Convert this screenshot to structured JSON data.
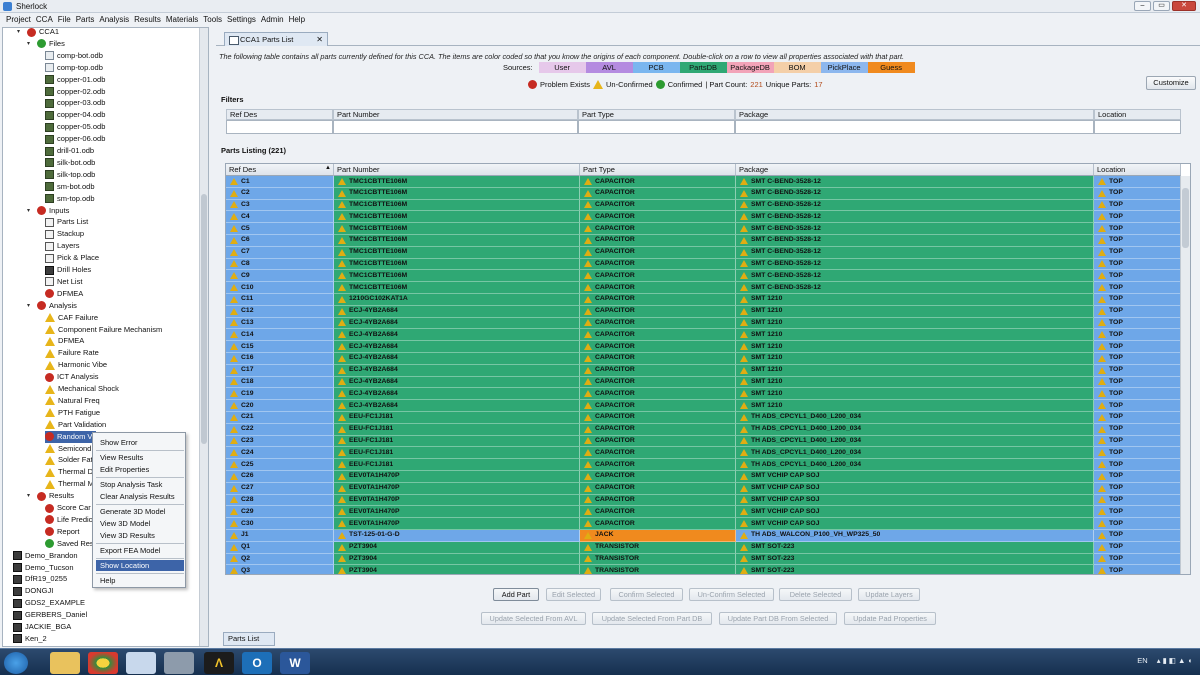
{
  "window": {
    "title": "Sherlock",
    "buttons": [
      "–",
      "▭",
      "✕"
    ]
  },
  "menu": [
    "Project",
    "CCA",
    "File",
    "Parts",
    "Analysis",
    "Results",
    "Materials",
    "Tools",
    "Settings",
    "Admin",
    "Help"
  ],
  "tree": {
    "top_node": "CCA1",
    "files_label": "Files",
    "files": [
      "comp-bot.odb",
      "comp-top.odb",
      "copper-01.odb",
      "copper-02.odb",
      "copper-03.odb",
      "copper-04.odb",
      "copper-05.odb",
      "copper-06.odb",
      "drill-01.odb",
      "silk-bot.odb",
      "silk-top.odb",
      "sm-bot.odb",
      "sm-top.odb"
    ],
    "inputs_label": "Inputs",
    "inputs": [
      {
        "label": "Parts List",
        "icon": "list"
      },
      {
        "label": "Stackup",
        "icon": "list"
      },
      {
        "label": "Layers",
        "icon": "list"
      },
      {
        "label": "Pick & Place",
        "icon": "list"
      },
      {
        "label": "Drill Holes",
        "icon": "dark"
      },
      {
        "label": "Net List",
        "icon": "list"
      },
      {
        "label": "DFMEA",
        "icon": "err"
      }
    ],
    "analysis_label": "Analysis",
    "analysis": [
      {
        "label": "CAF Failure",
        "icon": "warn"
      },
      {
        "label": "Component Failure Mechanism",
        "icon": "warn"
      },
      {
        "label": "DFMEA",
        "icon": "warn"
      },
      {
        "label": "Failure Rate",
        "icon": "warn"
      },
      {
        "label": "Harmonic Vibe",
        "icon": "warn"
      },
      {
        "label": "ICT Analysis",
        "icon": "err"
      },
      {
        "label": "Mechanical Shock",
        "icon": "warn"
      },
      {
        "label": "Natural Freq",
        "icon": "warn"
      },
      {
        "label": "PTH Fatigue",
        "icon": "warn"
      },
      {
        "label": "Part Validation",
        "icon": "warn"
      },
      {
        "label": "Random V",
        "icon": "err"
      },
      {
        "label": "Semicond",
        "icon": "warn"
      },
      {
        "label": "Solder Fati",
        "icon": "warn"
      },
      {
        "label": "Thermal D",
        "icon": "warn"
      },
      {
        "label": "Thermal M",
        "icon": "warn"
      }
    ],
    "results_label": "Results",
    "results": [
      {
        "label": "Score Car",
        "icon": "err"
      },
      {
        "label": "Life Predic",
        "icon": "err"
      },
      {
        "label": "Report",
        "icon": "err"
      },
      {
        "label": "Saved Res",
        "icon": "ok"
      }
    ],
    "projects": [
      "Demo_Brandon",
      "Demo_Tucson",
      "DfR19_0255",
      "DONGJI",
      "GDS2_EXAMPLE",
      "GERBERS_Daniel",
      "JACKIE_BGA",
      "Ken_2",
      "Kevin"
    ]
  },
  "context_menu": [
    "Show Error",
    "View Results",
    "Edit Properties",
    "Stop Analysis Task",
    "Clear Analysis Results",
    "Generate 3D Model",
    "View 3D Model",
    "View 3D Results",
    "Export FEA Model",
    "Show Location",
    "Help"
  ],
  "tab": {
    "label": "CCA1 Parts List",
    "close": "✕"
  },
  "description": "The following table contains all parts currently defined for this CCA. The items are color coded so that you know the origins of each component. Double-click on a row to view all properties associated with that part.",
  "sources": {
    "label": "Sources:",
    "items": [
      {
        "label": "User",
        "color": "#e6c8ea"
      },
      {
        "label": "AVL",
        "color": "#b48be0"
      },
      {
        "label": "PCB",
        "color": "#7ab6ef"
      },
      {
        "label": "PartsDB",
        "color": "#2fa874"
      },
      {
        "label": "PackageDB",
        "color": "#f2a3b8"
      },
      {
        "label": "BOM",
        "color": "#f4cfa8"
      },
      {
        "label": "PickPlace",
        "color": "#8cb7ee"
      },
      {
        "label": "Guess",
        "color": "#f08a1e"
      }
    ]
  },
  "legend": {
    "problem": "Problem Exists",
    "unconfirmed": "Un-Confirmed",
    "confirmed": "Confirmed",
    "part_count_label": "| Part Count:",
    "part_count": "221",
    "unique_label": "Unique Parts:",
    "unique": "17"
  },
  "customize_label": "Customize",
  "filters": {
    "title": "Filters",
    "columns": [
      "Ref Des",
      "Part Number",
      "Part Type",
      "Package",
      "Location"
    ]
  },
  "listing": {
    "title": "Parts Listing (221)",
    "columns": [
      "Ref Des",
      "Part Number",
      "Part Type",
      "Package",
      "Location"
    ],
    "rows": [
      [
        "C1",
        "TMC1CBTTE106M",
        "CAPACITOR",
        "SMT C-BEND-3528-12",
        "TOP"
      ],
      [
        "C2",
        "TMC1CBTTE106M",
        "CAPACITOR",
        "SMT C-BEND-3528-12",
        "TOP"
      ],
      [
        "C3",
        "TMC1CBTTE106M",
        "CAPACITOR",
        "SMT C-BEND-3528-12",
        "TOP"
      ],
      [
        "C4",
        "TMC1CBTTE106M",
        "CAPACITOR",
        "SMT C-BEND-3528-12",
        "TOP"
      ],
      [
        "C5",
        "TMC1CBTTE106M",
        "CAPACITOR",
        "SMT C-BEND-3528-12",
        "TOP"
      ],
      [
        "C6",
        "TMC1CBTTE106M",
        "CAPACITOR",
        "SMT C-BEND-3528-12",
        "TOP"
      ],
      [
        "C7",
        "TMC1CBTTE106M",
        "CAPACITOR",
        "SMT C-BEND-3528-12",
        "TOP"
      ],
      [
        "C8",
        "TMC1CBTTE106M",
        "CAPACITOR",
        "SMT C-BEND-3528-12",
        "TOP"
      ],
      [
        "C9",
        "TMC1CBTTE106M",
        "CAPACITOR",
        "SMT C-BEND-3528-12",
        "TOP"
      ],
      [
        "C10",
        "TMC1CBTTE106M",
        "CAPACITOR",
        "SMT C-BEND-3528-12",
        "TOP"
      ],
      [
        "C11",
        "1210GC102KAT1A",
        "CAPACITOR",
        "SMT 1210",
        "TOP"
      ],
      [
        "C12",
        "ECJ-4YB2A684",
        "CAPACITOR",
        "SMT 1210",
        "TOP"
      ],
      [
        "C13",
        "ECJ-4YB2A684",
        "CAPACITOR",
        "SMT 1210",
        "TOP"
      ],
      [
        "C14",
        "ECJ-4YB2A684",
        "CAPACITOR",
        "SMT 1210",
        "TOP"
      ],
      [
        "C15",
        "ECJ-4YB2A684",
        "CAPACITOR",
        "SMT 1210",
        "TOP"
      ],
      [
        "C16",
        "ECJ-4YB2A684",
        "CAPACITOR",
        "SMT 1210",
        "TOP"
      ],
      [
        "C17",
        "ECJ-4YB2A684",
        "CAPACITOR",
        "SMT 1210",
        "TOP"
      ],
      [
        "C18",
        "ECJ-4YB2A684",
        "CAPACITOR",
        "SMT 1210",
        "TOP"
      ],
      [
        "C19",
        "ECJ-4YB2A684",
        "CAPACITOR",
        "SMT 1210",
        "TOP"
      ],
      [
        "C20",
        "ECJ-4YB2A684",
        "CAPACITOR",
        "SMT 1210",
        "TOP"
      ],
      [
        "C21",
        "EEU-FC1J181",
        "CAPACITOR",
        "TH ADS_CPCYL1_D400_L200_034",
        "TOP"
      ],
      [
        "C22",
        "EEU-FC1J181",
        "CAPACITOR",
        "TH ADS_CPCYL1_D400_L200_034",
        "TOP"
      ],
      [
        "C23",
        "EEU-FC1J181",
        "CAPACITOR",
        "TH ADS_CPCYL1_D400_L200_034",
        "TOP"
      ],
      [
        "C24",
        "EEU-FC1J181",
        "CAPACITOR",
        "TH ADS_CPCYL1_D400_L200_034",
        "TOP"
      ],
      [
        "C25",
        "EEU-FC1J181",
        "CAPACITOR",
        "TH ADS_CPCYL1_D400_L200_034",
        "TOP"
      ],
      [
        "C26",
        "EEV0TA1H470P",
        "CAPACITOR",
        "SMT VCHIP CAP SOJ",
        "TOP"
      ],
      [
        "C27",
        "EEV0TA1H470P",
        "CAPACITOR",
        "SMT VCHIP CAP SOJ",
        "TOP"
      ],
      [
        "C28",
        "EEV0TA1H470P",
        "CAPACITOR",
        "SMT VCHIP CAP SOJ",
        "TOP"
      ],
      [
        "C29",
        "EEV0TA1H470P",
        "CAPACITOR",
        "SMT VCHIP CAP SOJ",
        "TOP"
      ],
      [
        "C30",
        "EEV0TA1H470P",
        "CAPACITOR",
        "SMT VCHIP CAP SOJ",
        "TOP"
      ],
      [
        "J1",
        "TST-125-01-G-D",
        "JACK",
        "TH ADS_WALCON_P100_VH_WP325_50",
        "TOP"
      ],
      [
        "Q1",
        "PZT3904",
        "TRANSISTOR",
        "SMT SOT-223",
        "TOP"
      ],
      [
        "Q2",
        "PZT3904",
        "TRANSISTOR",
        "SMT SOT-223",
        "TOP"
      ],
      [
        "Q3",
        "PZT3904",
        "TRANSISTOR",
        "SMT SOT-223",
        "TOP"
      ]
    ]
  },
  "buttons_row1": [
    {
      "label": "Add Part",
      "enabled": true
    },
    {
      "label": "Edit Selected",
      "enabled": false
    },
    {
      "label": "Confirm Selected",
      "enabled": false
    },
    {
      "label": "Un-Confirm Selected",
      "enabled": false
    },
    {
      "label": "Delete Selected",
      "enabled": false
    },
    {
      "label": "Update Layers",
      "enabled": false
    }
  ],
  "buttons_row2": [
    {
      "label": "Update Selected From AVL",
      "enabled": false
    },
    {
      "label": "Update Selected From Part DB",
      "enabled": false
    },
    {
      "label": "Update Part DB From Selected",
      "enabled": false
    },
    {
      "label": "Update Pad Properties",
      "enabled": false
    }
  ],
  "bottom_tab": "Parts List",
  "tray": {
    "lang": "EN",
    "time": ""
  }
}
